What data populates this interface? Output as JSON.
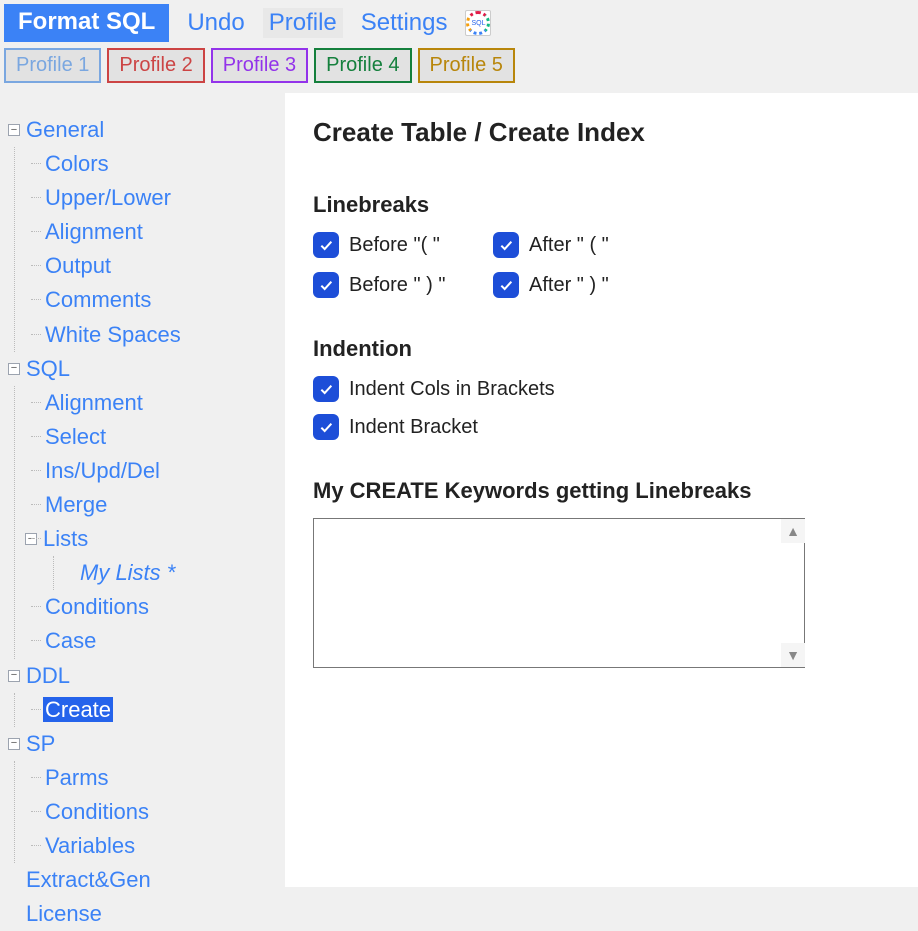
{
  "menubar": {
    "format_sql": "Format SQL",
    "undo": "Undo",
    "profile": "Profile",
    "settings": "Settings"
  },
  "profiles": [
    {
      "label": "Profile 1",
      "color": "#7aa7e0",
      "border": "#7aa7e0"
    },
    {
      "label": "Profile 2",
      "color": "#c44",
      "border": "#c44"
    },
    {
      "label": "Profile 3",
      "color": "#9333ea",
      "border": "#9333ea"
    },
    {
      "label": "Profile 4",
      "color": "#15803d",
      "border": "#15803d"
    },
    {
      "label": "Profile 5",
      "color": "#b8860b",
      "border": "#b8860b"
    }
  ],
  "tree": {
    "general": "General",
    "colors": "Colors",
    "upperlower": "Upper/Lower",
    "alignment1": "Alignment",
    "output": "Output",
    "comments": "Comments",
    "whitespaces": "White Spaces",
    "sql": "SQL",
    "alignment2": "Alignment",
    "select": "Select",
    "insupddel": "Ins/Upd/Del",
    "merge": "Merge",
    "lists": "Lists",
    "mylists": "My Lists *",
    "conditions1": "Conditions",
    "case": "Case",
    "ddl": "DDL",
    "create": "Create",
    "sp": "SP",
    "parms": "Parms",
    "conditions2": "Conditions",
    "variables": "Variables",
    "extractgen": "Extract&Gen",
    "license": "License"
  },
  "content": {
    "title": "Create Table / Create Index",
    "section_linebreaks": "Linebreaks",
    "before_open": "Before \"( \"",
    "after_open": "After \" ( \"",
    "before_close": "Before \" ) \"",
    "after_close": "After \" ) \"",
    "section_indention": "Indention",
    "indent_cols": "Indent Cols in Brackets",
    "indent_bracket": "Indent Bracket",
    "section_keywords": "My CREATE Keywords getting Linebreaks",
    "keywords_value": ""
  }
}
